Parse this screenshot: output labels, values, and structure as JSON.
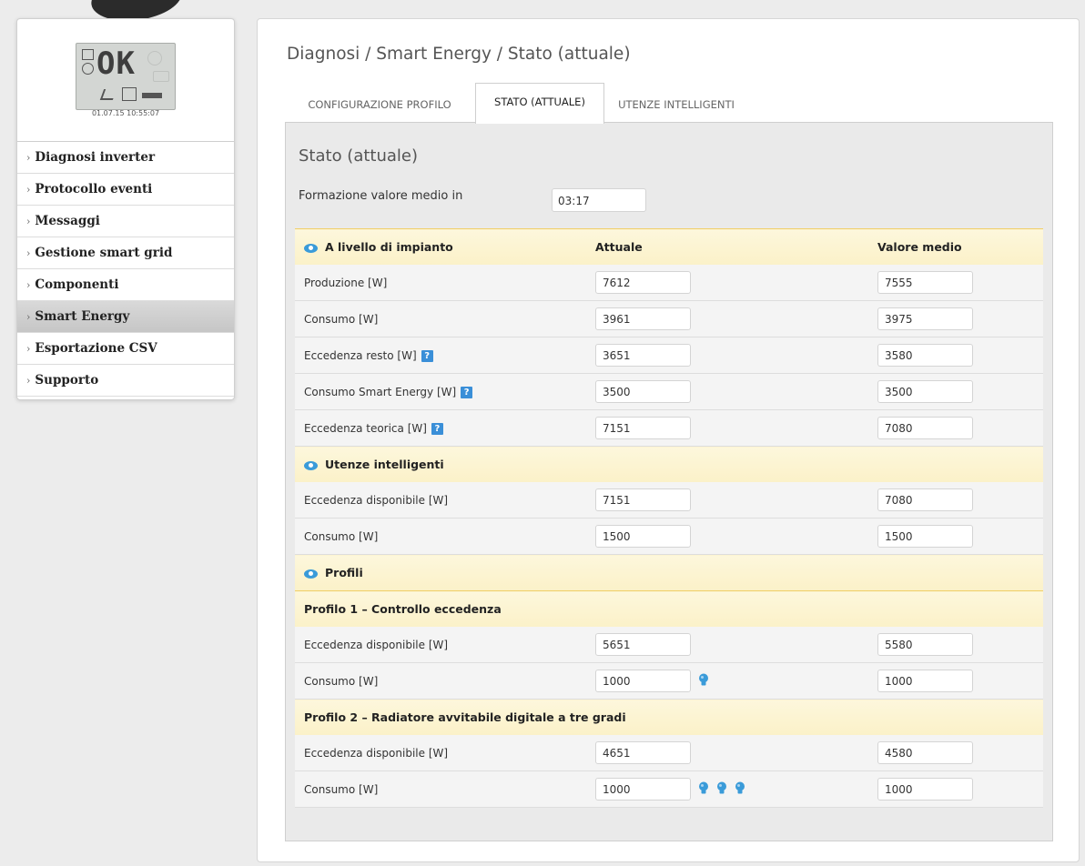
{
  "sidebar": {
    "display": {
      "status": "OK",
      "timestamp": "01.07.15 10:55:07"
    },
    "items": [
      {
        "label": "Diagnosi inverter"
      },
      {
        "label": "Protocollo eventi"
      },
      {
        "label": "Messaggi"
      },
      {
        "label": "Gestione smart grid"
      },
      {
        "label": "Componenti"
      },
      {
        "label": "Smart Energy",
        "active": true
      },
      {
        "label": "Esportazione CSV"
      },
      {
        "label": "Supporto"
      }
    ]
  },
  "breadcrumb": "Diagnosi / Smart Energy / Stato (attuale)",
  "tabs": [
    {
      "label": "CONFIGURAZIONE PROFILO"
    },
    {
      "label": "STATO (ATTUALE)",
      "active": true
    },
    {
      "label": "UTENZE INTELLIGENTI"
    }
  ],
  "section_title": "Stato (attuale)",
  "average": {
    "label": "Formazione valore medio in",
    "value": "03:17"
  },
  "columns": {
    "current": "Attuale",
    "average": "Valore medio"
  },
  "groups": {
    "plant": {
      "title": "A livello di impianto",
      "rows": [
        {
          "label": "Produzione [W]",
          "current": "7612",
          "average": "7555"
        },
        {
          "label": "Consumo [W]",
          "current": "3961",
          "average": "3975"
        },
        {
          "label": "Eccedenza resto [W]",
          "current": "3651",
          "average": "3580",
          "help": "?"
        },
        {
          "label": "Consumo Smart Energy [W]",
          "current": "3500",
          "average": "3500",
          "help": "?"
        },
        {
          "label": "Eccedenza teorica [W]",
          "current": "7151",
          "average": "7080",
          "help": "?"
        }
      ]
    },
    "smart_loads": {
      "title": "Utenze intelligenti",
      "rows": [
        {
          "label": "Eccedenza disponibile [W]",
          "current": "7151",
          "average": "7080"
        },
        {
          "label": "Consumo [W]",
          "current": "1500",
          "average": "1500"
        }
      ]
    },
    "profiles": {
      "title": "Profili",
      "profile1": {
        "title": "Profilo 1 – Controllo eccedenza",
        "rows": [
          {
            "label": "Eccedenza disponibile [W]",
            "current": "5651",
            "average": "5580"
          },
          {
            "label": "Consumo [W]",
            "current": "1000",
            "average": "1000",
            "active_stages": 1
          }
        ]
      },
      "profile2": {
        "title": "Profilo 2 – Radiatore avvitabile digitale a tre gradi",
        "rows": [
          {
            "label": "Eccedenza disponibile [W]",
            "current": "4651",
            "average": "4580"
          },
          {
            "label": "Consumo [W]",
            "current": "1000",
            "average": "1000",
            "active_stages": 3
          }
        ]
      }
    }
  },
  "colors": {
    "accent_blue": "#3a8fd8",
    "header_yellow": "#fbf1c8",
    "header_border": "#f0cf6a",
    "active_nav": "#c6c6c6"
  },
  "icons": [
    "eye-icon",
    "help-icon",
    "lightbulb-icon"
  ]
}
